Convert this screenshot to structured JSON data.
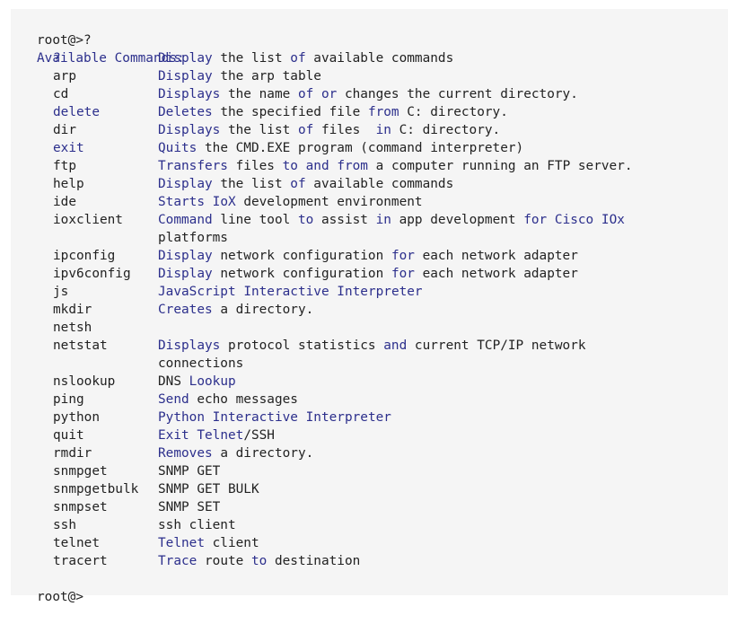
{
  "terminal": {
    "prompt_top": "root@>?",
    "heading": "Available Commands:",
    "prompt_bottom": "root@>",
    "colors": {
      "background": "#f5f5f5",
      "text": "#222222",
      "keyword": "#2c2f8c"
    },
    "commands": [
      {
        "cmd": "?",
        "desc": [
          [
            "Display",
            1
          ],
          [
            " the list ",
            0
          ],
          [
            "of",
            1
          ],
          [
            " available commands",
            0
          ]
        ],
        "desc_cont": [],
        "kw": true
      },
      {
        "cmd": "arp",
        "desc": [
          [
            "Display",
            1
          ],
          [
            " the arp table",
            0
          ]
        ],
        "desc_cont": [],
        "kw": false
      },
      {
        "cmd": "cd",
        "desc": [
          [
            "Displays",
            1
          ],
          [
            " the name ",
            0
          ],
          [
            "of",
            1
          ],
          [
            " ",
            0
          ],
          [
            "or",
            1
          ],
          [
            " changes the current directory.",
            0
          ]
        ],
        "desc_cont": [],
        "kw": false
      },
      {
        "cmd": "delete",
        "desc": [
          [
            "Deletes",
            1
          ],
          [
            " the specified file ",
            0
          ],
          [
            "from",
            1
          ],
          [
            " C: directory.",
            0
          ]
        ],
        "desc_cont": [],
        "kw": true
      },
      {
        "cmd": "dir",
        "desc": [
          [
            "Displays",
            1
          ],
          [
            " the list ",
            0
          ],
          [
            "of",
            1
          ],
          [
            " files  ",
            0
          ],
          [
            "in",
            1
          ],
          [
            " C: directory.",
            0
          ]
        ],
        "desc_cont": [],
        "kw": false
      },
      {
        "cmd": "exit",
        "desc": [
          [
            "Quits",
            1
          ],
          [
            " the CMD.EXE program (command interpreter)",
            0
          ]
        ],
        "desc_cont": [],
        "kw": true
      },
      {
        "cmd": "ftp",
        "desc": [
          [
            "Transfers",
            1
          ],
          [
            " files ",
            0
          ],
          [
            "to",
            1
          ],
          [
            " ",
            0
          ],
          [
            "and",
            1
          ],
          [
            " ",
            0
          ],
          [
            "from",
            1
          ],
          [
            " a computer running an FTP server.",
            0
          ]
        ],
        "desc_cont": [],
        "kw": false
      },
      {
        "cmd": "help",
        "desc": [
          [
            "Display",
            1
          ],
          [
            " the list ",
            0
          ],
          [
            "of",
            1
          ],
          [
            " available commands",
            0
          ]
        ],
        "desc_cont": [],
        "kw": false
      },
      {
        "cmd": "ide",
        "desc": [
          [
            "Starts",
            1
          ],
          [
            " ",
            0
          ],
          [
            "IoX",
            1
          ],
          [
            " development environment",
            0
          ]
        ],
        "desc_cont": [],
        "kw": false
      },
      {
        "cmd": "ioxclient",
        "desc": [
          [
            "Command",
            1
          ],
          [
            " line tool ",
            0
          ],
          [
            "to",
            1
          ],
          [
            " assist ",
            0
          ],
          [
            "in",
            1
          ],
          [
            " app development ",
            0
          ],
          [
            "for",
            1
          ],
          [
            " ",
            0
          ],
          [
            "Cisco",
            1
          ],
          [
            " ",
            0
          ],
          [
            "IOx",
            1
          ]
        ],
        "desc_cont": [
          [
            "platforms",
            0
          ]
        ],
        "kw": false
      },
      {
        "cmd": "ipconfig",
        "desc": [
          [
            "Display",
            1
          ],
          [
            " network configuration ",
            0
          ],
          [
            "for",
            1
          ],
          [
            " each network adapter",
            0
          ]
        ],
        "desc_cont": [],
        "kw": false
      },
      {
        "cmd": "ipv6config",
        "desc": [
          [
            "Display",
            1
          ],
          [
            " network configuration ",
            0
          ],
          [
            "for",
            1
          ],
          [
            " each network adapter",
            0
          ]
        ],
        "desc_cont": [],
        "kw": false
      },
      {
        "cmd": "js",
        "desc": [
          [
            "JavaScript",
            1
          ],
          [
            " ",
            0
          ],
          [
            "Interactive",
            1
          ],
          [
            " ",
            0
          ],
          [
            "Interpreter",
            1
          ]
        ],
        "desc_cont": [],
        "kw": false
      },
      {
        "cmd": "mkdir",
        "desc": [
          [
            "Creates",
            1
          ],
          [
            " a directory.",
            0
          ]
        ],
        "desc_cont": [],
        "kw": false
      },
      {
        "cmd": "netsh",
        "desc": [],
        "desc_cont": [],
        "kw": false
      },
      {
        "cmd": "netstat",
        "desc": [
          [
            "Displays",
            1
          ],
          [
            " protocol statistics ",
            0
          ],
          [
            "and",
            1
          ],
          [
            " current TCP/IP network",
            0
          ]
        ],
        "desc_cont": [
          [
            "connections",
            0
          ]
        ],
        "kw": false
      },
      {
        "cmd": "nslookup",
        "desc": [
          [
            "DNS",
            0
          ],
          [
            " ",
            0
          ],
          [
            "Lookup",
            1
          ]
        ],
        "desc_cont": [],
        "kw": false
      },
      {
        "cmd": "ping",
        "desc": [
          [
            "Send",
            1
          ],
          [
            " echo messages",
            0
          ]
        ],
        "desc_cont": [],
        "kw": false
      },
      {
        "cmd": "python",
        "desc": [
          [
            "Python",
            1
          ],
          [
            " ",
            0
          ],
          [
            "Interactive",
            1
          ],
          [
            " ",
            0
          ],
          [
            "Interpreter",
            1
          ]
        ],
        "desc_cont": [],
        "kw": false
      },
      {
        "cmd": "quit",
        "desc": [
          [
            "Exit",
            1
          ],
          [
            " ",
            0
          ],
          [
            "Telnet",
            1
          ],
          [
            "/SSH",
            0
          ]
        ],
        "desc_cont": [],
        "kw": false
      },
      {
        "cmd": "rmdir",
        "desc": [
          [
            "Removes",
            1
          ],
          [
            " a directory.",
            0
          ]
        ],
        "desc_cont": [],
        "kw": false
      },
      {
        "cmd": "snmpget",
        "desc": [
          [
            "SNMP GET",
            0
          ]
        ],
        "desc_cont": [],
        "kw": false
      },
      {
        "cmd": "snmpgetbulk",
        "desc": [
          [
            "SNMP GET BULK",
            0
          ]
        ],
        "desc_cont": [],
        "kw": false
      },
      {
        "cmd": "snmpset",
        "desc": [
          [
            "SNMP SET",
            0
          ]
        ],
        "desc_cont": [],
        "kw": false
      },
      {
        "cmd": "ssh",
        "desc": [
          [
            "ssh client",
            0
          ]
        ],
        "desc_cont": [],
        "kw": false
      },
      {
        "cmd": "telnet",
        "desc": [
          [
            "Telnet",
            1
          ],
          [
            " client",
            0
          ]
        ],
        "desc_cont": [],
        "kw": false
      },
      {
        "cmd": "tracert",
        "desc": [
          [
            "Trace",
            1
          ],
          [
            " route ",
            0
          ],
          [
            "to",
            1
          ],
          [
            " destination",
            0
          ]
        ],
        "desc_cont": [],
        "kw": false
      }
    ]
  }
}
